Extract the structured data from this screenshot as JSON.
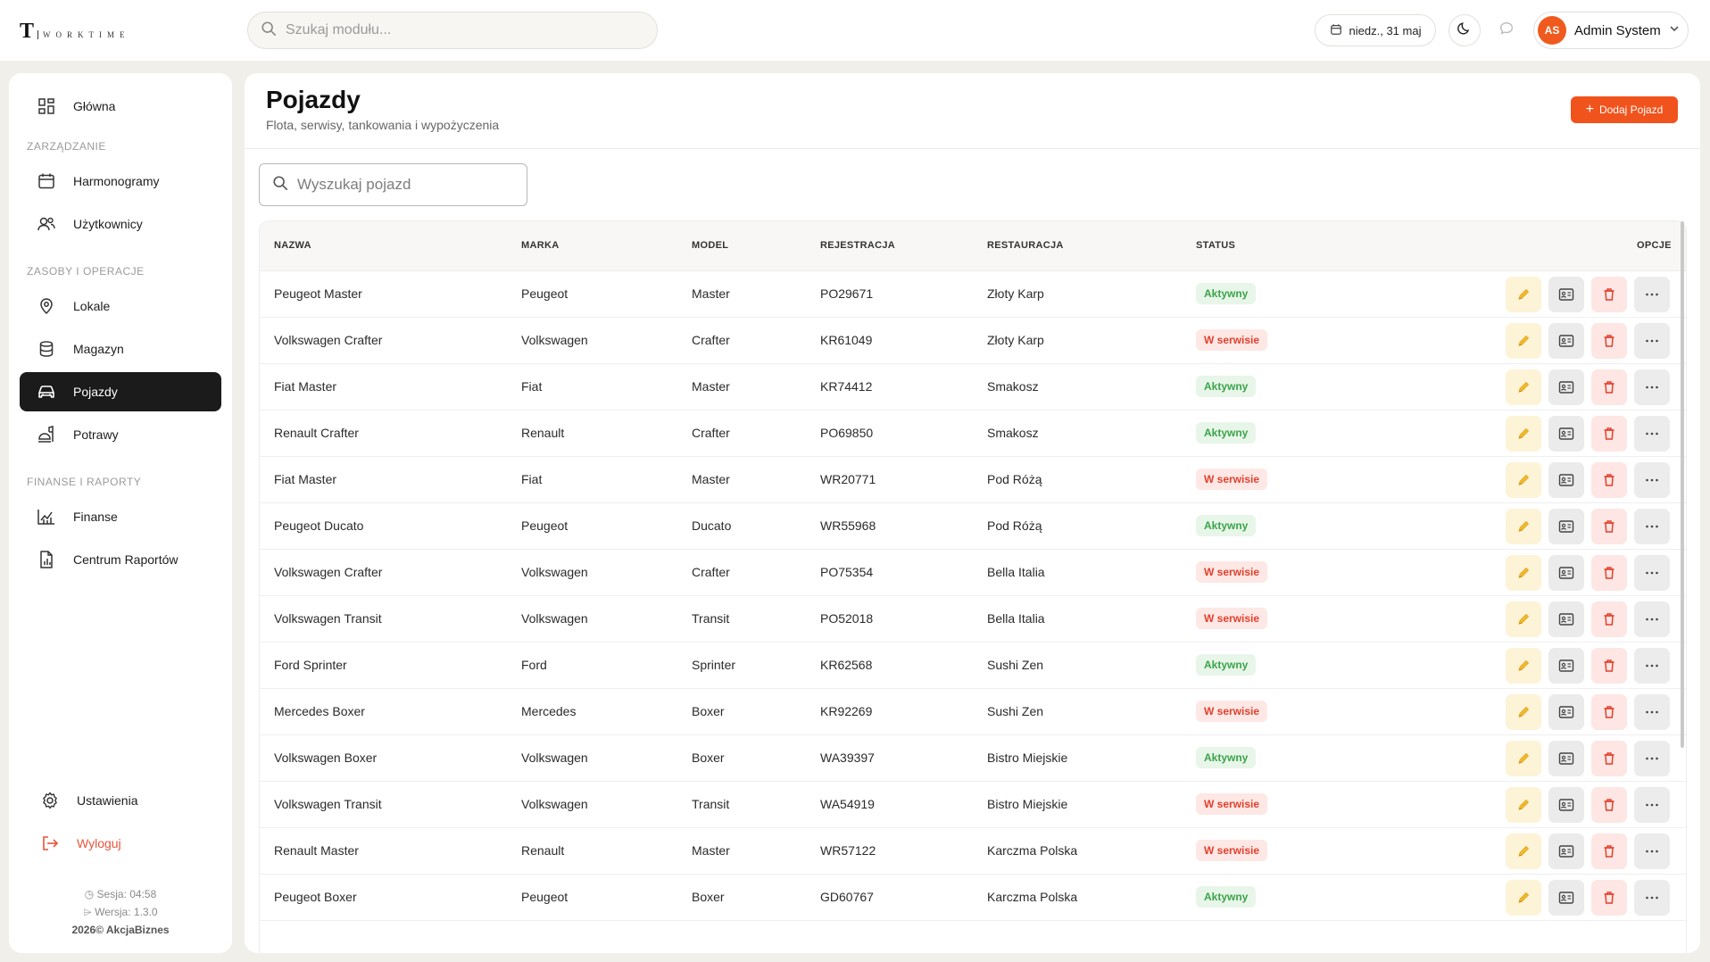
{
  "app": {
    "logo_letter": "T",
    "logo_text": "WORKTIME",
    "search_placeholder": "Szukaj modułu...",
    "date": "niedz., 31 maj",
    "user_initials": "AS",
    "user_name": "Admin System"
  },
  "sidebar": {
    "home": "Główna",
    "section_manage": "ZARZĄDZANIE",
    "schedules": "Harmonogramy",
    "users": "Użytkownicy",
    "section_resources": "ZASOBY I OPERACJE",
    "locations": "Lokale",
    "warehouse": "Magazyn",
    "vehicles": "Pojazdy",
    "dishes": "Potrawy",
    "section_finance": "FINANSE I RAPORTY",
    "finance": "Finanse",
    "reports": "Centrum Raportów",
    "settings": "Ustawienia",
    "logout": "Wyloguj",
    "session": "Sesja: 04:58",
    "version": "Wersja: 1.3.0",
    "copyright": "2026© AkcjaBiznes"
  },
  "page": {
    "title": "Pojazdy",
    "subtitle": "Flota, serwisy, tankowania i wypożyczenia",
    "add_button": "Dodaj Pojazd",
    "search_placeholder": "Wyszukaj pojazd"
  },
  "table": {
    "headers": [
      "NAZWA",
      "MARKA",
      "MODEL",
      "REJESTRACJA",
      "RESTAURACJA",
      "STATUS",
      "OPCJE"
    ],
    "rows": [
      {
        "name": "Peugeot Master",
        "brand": "Peugeot",
        "model": "Master",
        "reg": "PO29671",
        "restaurant": "Złoty Karp",
        "status": "Aktywny"
      },
      {
        "name": "Volkswagen Crafter",
        "brand": "Volkswagen",
        "model": "Crafter",
        "reg": "KR61049",
        "restaurant": "Złoty Karp",
        "status": "W serwisie"
      },
      {
        "name": "Fiat Master",
        "brand": "Fiat",
        "model": "Master",
        "reg": "KR74412",
        "restaurant": "Smakosz",
        "status": "Aktywny"
      },
      {
        "name": "Renault Crafter",
        "brand": "Renault",
        "model": "Crafter",
        "reg": "PO69850",
        "restaurant": "Smakosz",
        "status": "Aktywny"
      },
      {
        "name": "Fiat Master",
        "brand": "Fiat",
        "model": "Master",
        "reg": "WR20771",
        "restaurant": "Pod Różą",
        "status": "W serwisie"
      },
      {
        "name": "Peugeot Ducato",
        "brand": "Peugeot",
        "model": "Ducato",
        "reg": "WR55968",
        "restaurant": "Pod Różą",
        "status": "Aktywny"
      },
      {
        "name": "Volkswagen Crafter",
        "brand": "Volkswagen",
        "model": "Crafter",
        "reg": "PO75354",
        "restaurant": "Bella Italia",
        "status": "W serwisie"
      },
      {
        "name": "Volkswagen Transit",
        "brand": "Volkswagen",
        "model": "Transit",
        "reg": "PO52018",
        "restaurant": "Bella Italia",
        "status": "W serwisie"
      },
      {
        "name": "Ford Sprinter",
        "brand": "Ford",
        "model": "Sprinter",
        "reg": "KR62568",
        "restaurant": "Sushi Zen",
        "status": "Aktywny"
      },
      {
        "name": "Mercedes Boxer",
        "brand": "Mercedes",
        "model": "Boxer",
        "reg": "KR92269",
        "restaurant": "Sushi Zen",
        "status": "W serwisie"
      },
      {
        "name": "Volkswagen Boxer",
        "brand": "Volkswagen",
        "model": "Boxer",
        "reg": "WA39397",
        "restaurant": "Bistro Miejskie",
        "status": "Aktywny"
      },
      {
        "name": "Volkswagen Transit",
        "brand": "Volkswagen",
        "model": "Transit",
        "reg": "WA54919",
        "restaurant": "Bistro Miejskie",
        "status": "W serwisie"
      },
      {
        "name": "Renault Master",
        "brand": "Renault",
        "model": "Master",
        "reg": "WR57122",
        "restaurant": "Karczma Polska",
        "status": "W serwisie"
      },
      {
        "name": "Peugeot Boxer",
        "brand": "Peugeot",
        "model": "Boxer",
        "reg": "GD60767",
        "restaurant": "Karczma Polska",
        "status": "Aktywny"
      }
    ]
  },
  "colors": {
    "accent": "#f0531c",
    "active_nav": "#1b1b1b",
    "status_ok": "#3aa44a",
    "status_service": "#e2402d"
  }
}
